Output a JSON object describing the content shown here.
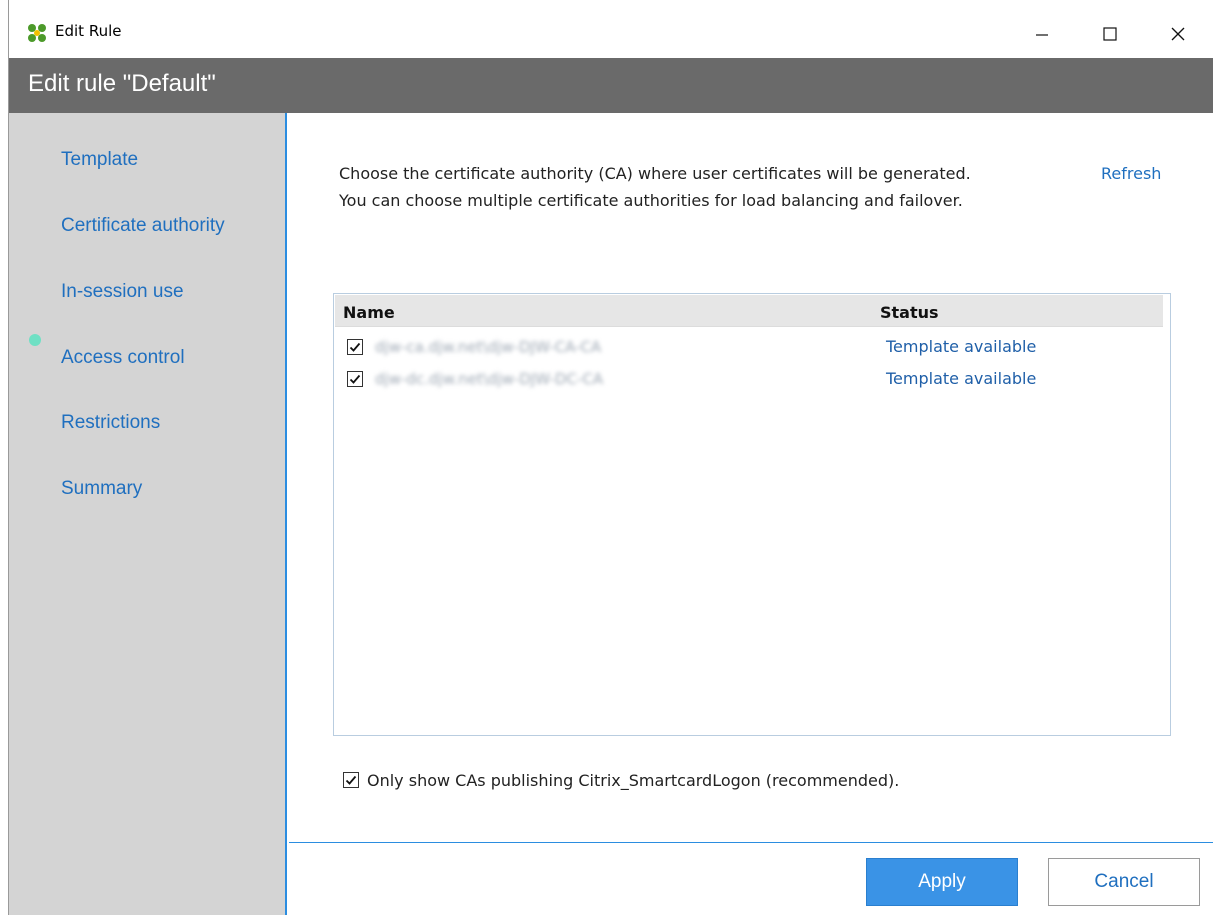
{
  "window": {
    "title": "Edit Rule",
    "controls": {
      "minimize": "minimize-icon",
      "maximize": "maximize-icon",
      "close": "close-icon"
    }
  },
  "header": {
    "title": "Edit rule \"Default\""
  },
  "sidebar": {
    "items": [
      {
        "label": "Template",
        "active": false
      },
      {
        "label": "Certificate authority",
        "active": true
      },
      {
        "label": "In-session use",
        "active": false
      },
      {
        "label": "Access control",
        "active": false
      },
      {
        "label": "Restrictions",
        "active": false
      },
      {
        "label": "Summary",
        "active": false
      }
    ],
    "active_indicator_color": "#6fe0c4"
  },
  "main": {
    "description_line1": "Choose the certificate authority (CA) where user certificates will be generated.",
    "description_line2": "You can choose multiple certificate authorities for load balancing and failover.",
    "refresh_label": "Refresh",
    "table": {
      "columns": [
        "Name",
        "Status"
      ],
      "rows": [
        {
          "checked": true,
          "name": "djw-ca.djw.net\\djw-DJW-CA-CA",
          "status": "Template available"
        },
        {
          "checked": true,
          "name": "djw-dc.djw.net\\djw-DJW-DC-CA",
          "status": "Template available"
        }
      ]
    },
    "filter_option": {
      "checked": true,
      "label": "Only show CAs publishing Citrix_SmartcardLogon (recommended)."
    }
  },
  "footer": {
    "apply_label": "Apply",
    "cancel_label": "Cancel"
  },
  "colors": {
    "accent": "#2b8de0",
    "link": "#1f6fbf",
    "header_bg": "#6a6a6a",
    "sidebar_bg": "#d4d4d4",
    "apply_bg": "#3a93e6"
  }
}
